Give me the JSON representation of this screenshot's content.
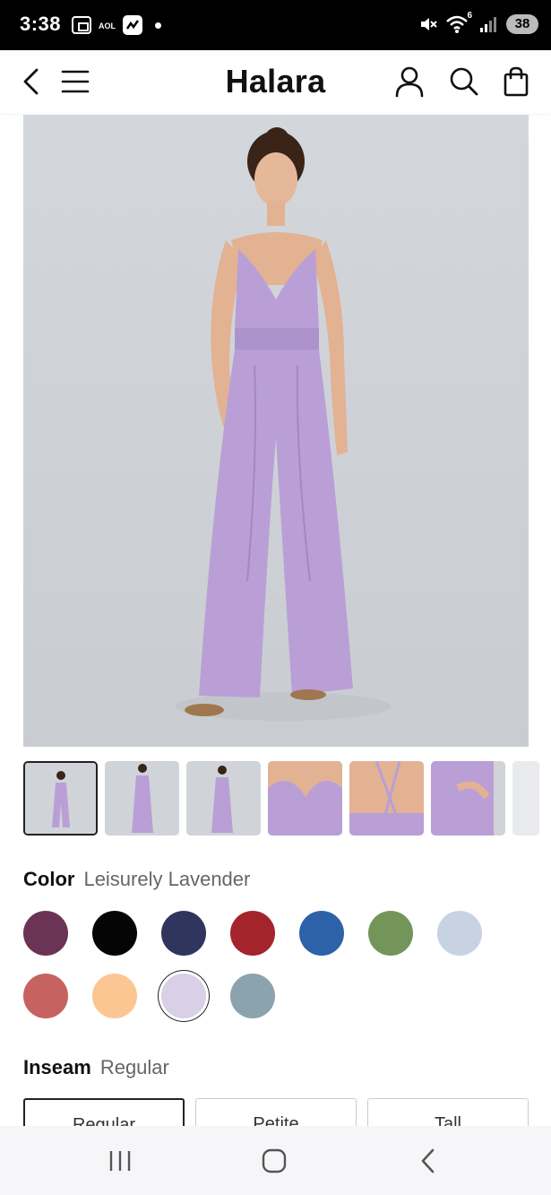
{
  "status_bar": {
    "time": "3:38",
    "notif_aol": "AOL",
    "signal_label": "6",
    "battery": "38"
  },
  "header": {
    "brand": "Halara",
    "icons": [
      "back-arrow-icon",
      "menu-icon",
      "account-icon",
      "search-icon",
      "shopping-bag-icon"
    ]
  },
  "product": {
    "hero_colors": {
      "background": "#d0d4d9",
      "garment": "#b99fd6",
      "skin": "#e6b89a"
    },
    "thumbnail_count_visible": 7
  },
  "color": {
    "label": "Color",
    "selected_name": "Leisurely Lavender",
    "swatches": [
      "#6b3454",
      "#050505",
      "#2f355c",
      "#a3242b",
      "#2d62a8",
      "#74955a",
      "#c7d3e2",
      "#c66260",
      "#fbc692",
      "#d9cfe6",
      "#8aa3ad"
    ],
    "selected_index": 9
  },
  "inseam": {
    "label": "Inseam",
    "selected": "Regular",
    "options": [
      "Regular",
      "Petite",
      "Tall"
    ]
  },
  "nav_bar": {
    "icons": [
      "recent-apps-icon",
      "home-icon",
      "back-icon"
    ]
  }
}
